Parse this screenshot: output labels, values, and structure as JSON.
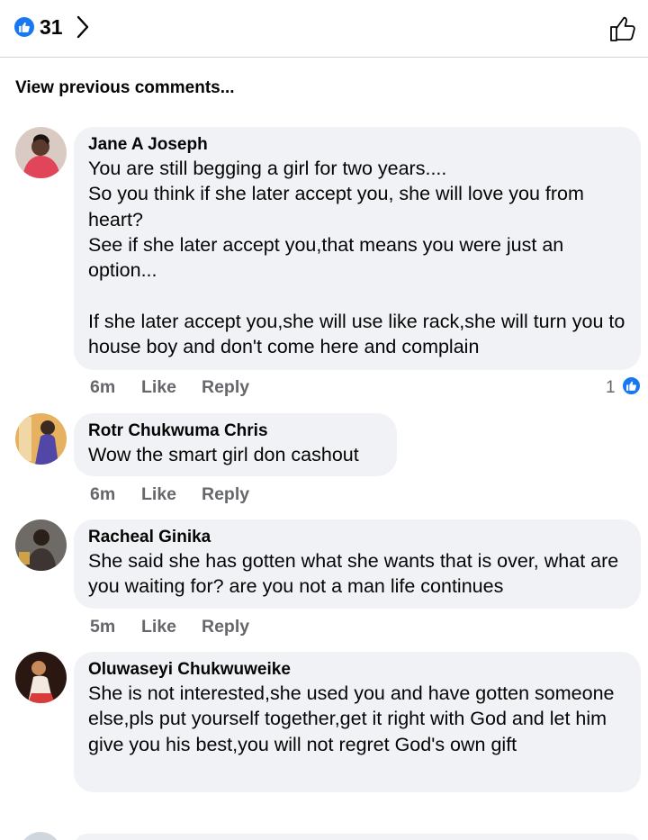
{
  "header": {
    "reaction_count": "31",
    "icons": {
      "reaction": "like-icon",
      "chevron": "chevron-right-icon",
      "like_action": "like-outline-icon"
    }
  },
  "view_previous": "View previous comments...",
  "comments": [
    {
      "author": "Jane A Joseph",
      "text": "You are still begging a girl for two years....\nSo you think if she later accept you, she will love you from heart?\nSee if she later accept you,that means you were just an option...\n\nIf she later accept you,she will use like rack,she will turn you to house boy and don't come here and complain",
      "time": "6m",
      "like": "Like",
      "reply": "Reply",
      "reactions": "1"
    },
    {
      "author": "Rotr Chukwuma Chris",
      "text": "Wow the smart girl don cashout",
      "time": "6m",
      "like": "Like",
      "reply": "Reply"
    },
    {
      "author": "Racheal Ginika",
      "text": "She said she has gotten what she wants that is over, what are you waiting for? are you not a man life continues",
      "time": "5m",
      "like": "Like",
      "reply": "Reply"
    },
    {
      "author": "Oluwaseyi Chukwuweike",
      "text": "She is not interested,she used you and have gotten someone else,pls put yourself together,get it right with God and let him give you his best,you will not regret God's own gift"
    }
  ],
  "colors": {
    "accent": "#1877f2",
    "bubble": "#f0f2f5",
    "muted": "#65676b"
  }
}
